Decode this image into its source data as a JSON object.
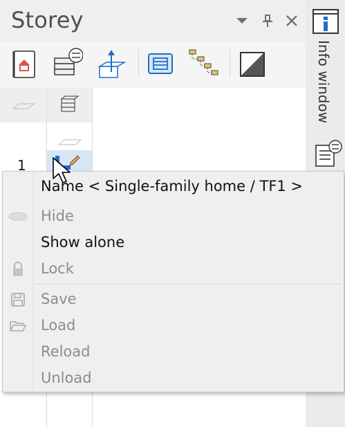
{
  "panel": {
    "title": "Storey",
    "title_buttons": [
      {
        "name": "dropdown-icon",
        "glyph": "▾"
      },
      {
        "name": "pin-icon",
        "glyph": "⊥"
      },
      {
        "name": "close-icon",
        "glyph": "✕"
      }
    ]
  },
  "toolbar": {
    "tools": [
      "notebook-icon",
      "layer-settings-icon",
      "storey-height-icon",
      "list-view-icon",
      "hierarchy-icon",
      "contrast-icon"
    ]
  },
  "grid": {
    "rows": [
      {
        "number": "1"
      }
    ]
  },
  "sidebar": {
    "info_tab_label": "Info window"
  },
  "context_menu": {
    "name_item": "Name < Single-family home / TF1 >",
    "items": [
      {
        "label": "Hide",
        "enabled": false,
        "icon": "eye-icon"
      },
      {
        "label": "Show alone",
        "enabled": true,
        "icon": ""
      },
      {
        "label": "Lock",
        "enabled": false,
        "icon": "lock-icon"
      },
      {
        "label": "Save",
        "enabled": false,
        "icon": "save-icon"
      },
      {
        "label": "Load",
        "enabled": false,
        "icon": "folder-open-icon"
      },
      {
        "label": "Reload",
        "enabled": false,
        "icon": ""
      },
      {
        "label": "Unload",
        "enabled": false,
        "icon": ""
      }
    ]
  },
  "colors": {
    "accent_blue": "#1e6fc4",
    "folder_yellow": "#e8c46a",
    "house_red": "#d9534f"
  }
}
